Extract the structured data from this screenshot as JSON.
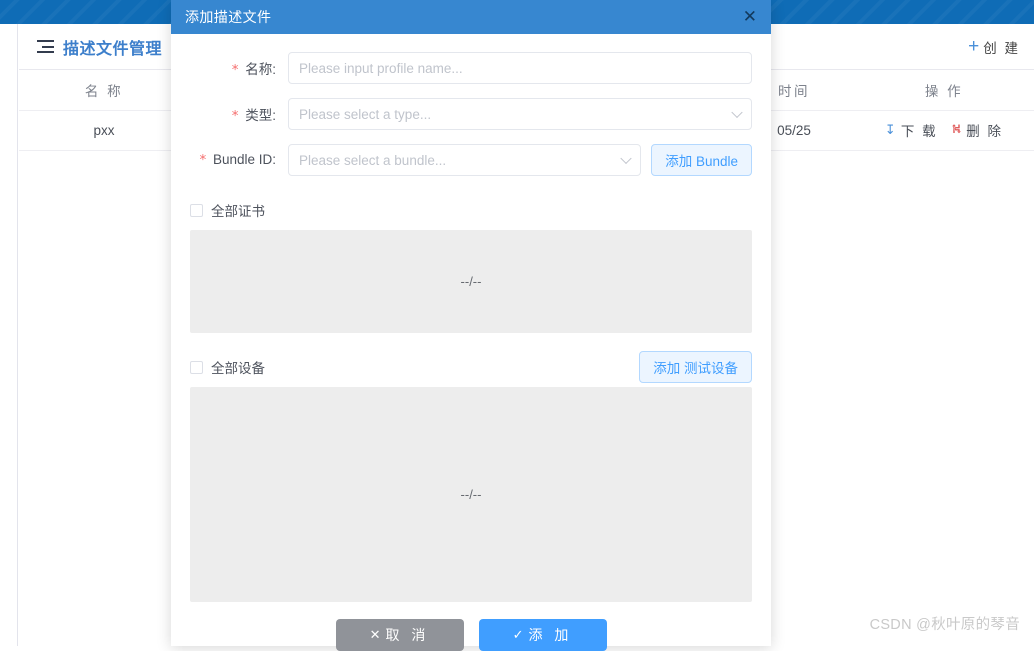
{
  "background": {
    "page_title": "描述文件管理",
    "menu_icon": "hamburger-icon",
    "create_button": {
      "label": "创 建",
      "icon": "plus-icon"
    },
    "table": {
      "headers": [
        "名 称",
        "时间",
        "操 作"
      ],
      "rows": [
        {
          "name": "pxx",
          "time": "05/25",
          "actions": [
            {
              "label": "下 载",
              "icon": "download-icon",
              "color": "#4a90d9"
            },
            {
              "label": "删 除",
              "icon": "trash-icon",
              "color": "#e05b5b"
            }
          ]
        }
      ]
    },
    "watermark": "CSDN @秋叶原的琴音"
  },
  "modal": {
    "title": "添加描述文件",
    "close_icon": "close-icon",
    "header_color": "#3787d0",
    "fields": [
      {
        "label": "名称:",
        "required": true,
        "type": "text",
        "placeholder": "Please input profile name...",
        "value": ""
      },
      {
        "label": "类型:",
        "required": true,
        "type": "select",
        "placeholder": "Please select a type...",
        "value": ""
      },
      {
        "label": "Bundle ID:",
        "required": true,
        "type": "select",
        "placeholder": "Please select a bundle...",
        "value": "",
        "side_button": "添加 Bundle"
      }
    ],
    "cert_section": {
      "checkbox_label": "全部证书",
      "checked": false,
      "empty_text": "--/--"
    },
    "device_section": {
      "checkbox_label": "全部设备",
      "checked": false,
      "add_button": "添加 测试设备",
      "empty_text": "--/--"
    },
    "footer": {
      "cancel": {
        "label": "取 消",
        "icon": "cross-icon",
        "glyph": "✕"
      },
      "confirm": {
        "label": "添 加",
        "icon": "check-icon",
        "glyph": "✓"
      }
    }
  }
}
